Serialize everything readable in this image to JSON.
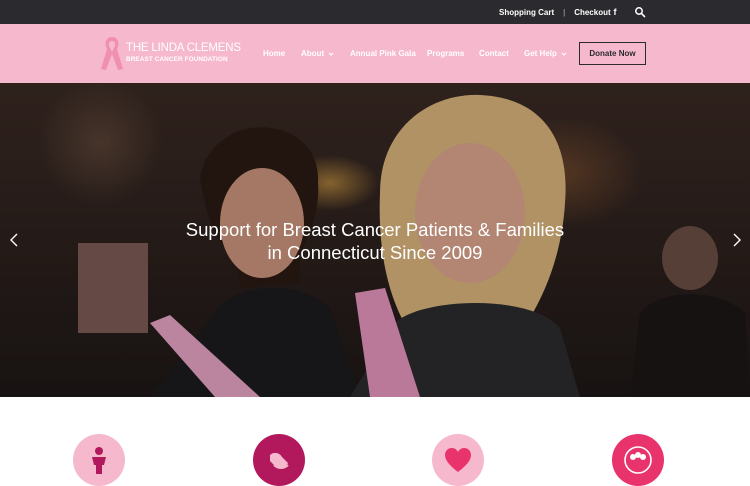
{
  "topbar": {
    "shopping_cart": "Shopping Cart",
    "separator": "|",
    "checkout": "Checkout",
    "facebook_icon": "f",
    "search_icon": "search-icon"
  },
  "header": {
    "logo": {
      "line1": "THE LINDA CLEMENS",
      "line2": "BREAST CANCER FOUNDATION",
      "icon": "pink-ribbon-icon"
    },
    "nav": [
      {
        "label": "Home",
        "has_dropdown": false
      },
      {
        "label": "About",
        "has_dropdown": true
      },
      {
        "label": "Annual Pink Gala",
        "has_dropdown": false
      },
      {
        "label": "Programs",
        "has_dropdown": false
      },
      {
        "label": "Contact",
        "has_dropdown": false
      },
      {
        "label": "Get Help",
        "has_dropdown": true
      }
    ],
    "donate_label": "Donate Now"
  },
  "hero": {
    "headline_line1": "Support for Breast Cancer Patients & Families",
    "headline_line2": "in Connecticut Since 2009",
    "prev_icon": "chevron-left-icon",
    "next_icon": "chevron-right-icon"
  },
  "features": [
    {
      "icon": "person-icon",
      "color": "#f6b8cd",
      "icon_color": "#b2195c"
    },
    {
      "icon": "helping-hands-icon",
      "color": "#b2195c",
      "icon_color": "#f6b8cd"
    },
    {
      "icon": "heart-icon",
      "color": "#f6b8cd",
      "icon_color": "#e8336d"
    },
    {
      "icon": "group-icon",
      "color": "#e8336d",
      "icon_color": "#ffffff"
    }
  ],
  "colors": {
    "topbar_bg": "#2b2b2f",
    "header_bg": "#f6b8cd",
    "accent": "#b2195c"
  }
}
